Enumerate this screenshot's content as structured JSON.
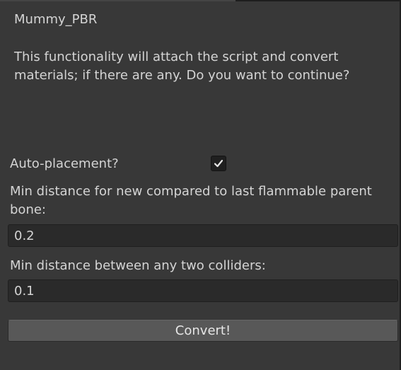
{
  "window": {
    "title": "Mummy_PBR"
  },
  "dialog": {
    "message": "This functionality will attach the script and convert materials; if there are any. Do you want to continue?"
  },
  "auto_placement": {
    "label": "Auto-placement?",
    "checked": true
  },
  "min_distance_parent": {
    "label": "Min distance for new compared to last flammable parent bone:",
    "value": "0.2"
  },
  "min_distance_colliders": {
    "label": "Min distance between any two colliders:",
    "value": "0.1"
  },
  "actions": {
    "convert_label": "Convert!"
  },
  "colors": {
    "background": "#383838",
    "field_background": "#2a2a2a",
    "button_background": "#585858",
    "text": "#d4d4d4"
  },
  "icons": {
    "checkbox": "checkmark-icon"
  }
}
